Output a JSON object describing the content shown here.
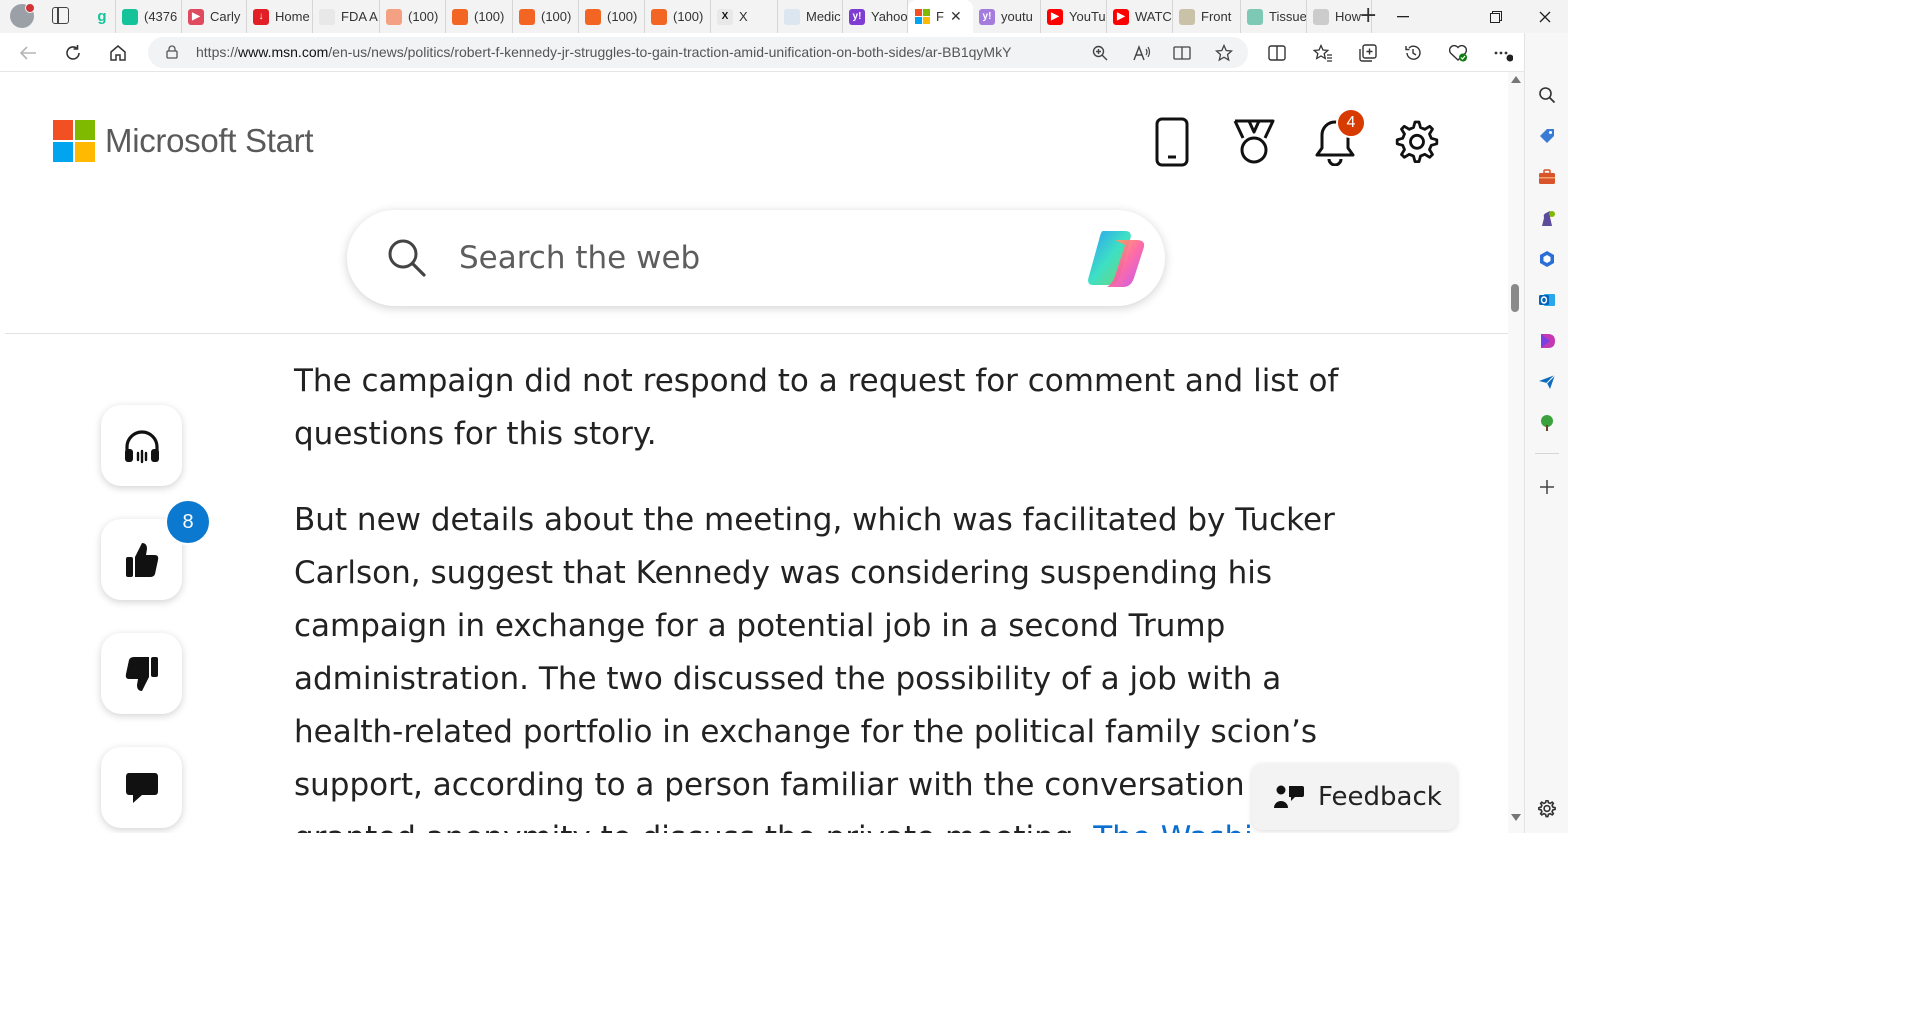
{
  "browser": {
    "tabs": [
      {
        "label": "",
        "icon": "grammarly-icon",
        "color": "#15c39a",
        "glyph": "g"
      },
      {
        "label": "(4376",
        "icon": "grammarly-icon",
        "color": "#15c39a",
        "glyph": ""
      },
      {
        "label": "Carly",
        "icon": "youtube-icon",
        "color": "#e04a5f",
        "glyph": "▶"
      },
      {
        "label": "Home",
        "icon": "news-icon",
        "color": "#e21f26",
        "glyph": "↓"
      },
      {
        "label": "FDA A",
        "icon": "document-icon",
        "color": "#e8e8e8",
        "glyph": ""
      },
      {
        "label": "(100)",
        "icon": "substack-icon",
        "color": "#f4a083",
        "glyph": ""
      },
      {
        "label": "(100)",
        "icon": "substack-icon",
        "color": "#f26522",
        "glyph": ""
      },
      {
        "label": "(100)",
        "icon": "substack-icon",
        "color": "#f26522",
        "glyph": ""
      },
      {
        "label": "(100)",
        "icon": "substack-icon",
        "color": "#f26522",
        "glyph": ""
      },
      {
        "label": "(100)",
        "icon": "substack-icon",
        "color": "#f26522",
        "glyph": ""
      },
      {
        "label": "X",
        "icon": "x-icon",
        "color": "#777777",
        "glyph": "X"
      },
      {
        "label": "Medic",
        "icon": "medical-icon",
        "color": "#dce6f0",
        "glyph": ""
      },
      {
        "label": "Yahoo",
        "icon": "yahoo-icon",
        "color": "#7e3cd3",
        "glyph": "y!"
      },
      {
        "label": "F",
        "icon": "msn-icon",
        "color": "#ffffff",
        "glyph": "",
        "active": true
      },
      {
        "label": "youtu",
        "icon": "yahoo-icon",
        "color": "#a37cde",
        "glyph": "y!"
      },
      {
        "label": "YouTu",
        "icon": "youtube-icon",
        "color": "#ff0000",
        "glyph": "▶"
      },
      {
        "label": "WATC",
        "icon": "youtube-icon",
        "color": "#ff0000",
        "glyph": "▶"
      },
      {
        "label": "Front",
        "icon": "front-icon",
        "color": "#c9c2a8",
        "glyph": ""
      },
      {
        "label": "Tissue",
        "icon": "tissue-icon",
        "color": "#7ec9b5",
        "glyph": ""
      },
      {
        "label": "How",
        "icon": "circle-icon",
        "color": "#cccccc",
        "glyph": ""
      }
    ],
    "url_prefix": "https://",
    "url_domain": "www.msn.com",
    "url_path": "/en-us/news/politics/robert-f-kennedy-jr-struggles-to-gain-traction-amid-unification-on-both-sides/ar-BB1qyMkY"
  },
  "header": {
    "brand": "Microsoft Start",
    "notification_count": "4",
    "logo_colors": [
      "#f25022",
      "#7fba00",
      "#00a4ef",
      "#ffb900"
    ]
  },
  "search": {
    "placeholder": "Search the web"
  },
  "article": {
    "paragraph_1": "The campaign did not respond to a request for comment and list of questions for this story.",
    "paragraph_2": "But new details about the meeting, which was facilitated by Tucker Carlson, suggest that Kennedy was considering suspending his campaign in exchange for a potential job in a second Trump administration. The two discussed the possibility of a job with a health-related portfolio in exchange for the political family scion’s support, according to a person familiar with the conversation",
    "paragraph_2_cutoff": "granted anonymity to discuss the private meeting.",
    "link_text": "The Washi"
  },
  "actions": {
    "like_count": "8"
  },
  "feedback": {
    "label": "Feedback"
  },
  "colors": {
    "accent": "#0b79d0",
    "badge": "#d83b01",
    "link": "#0a6ed1"
  }
}
